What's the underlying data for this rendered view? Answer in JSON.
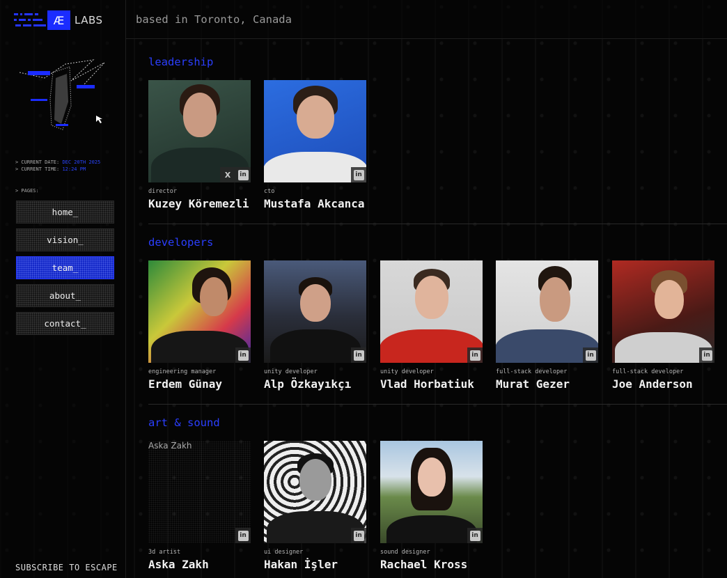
{
  "brand": {
    "logo_mark": "Æ",
    "logo_text": "LABS"
  },
  "header": {
    "location": "based in Toronto, Canada"
  },
  "sidebar": {
    "meta": {
      "date_label": "> CURRENT DATE:",
      "date_value": "DEC 20TH 2025",
      "time_label": "> CURRENT TIME:",
      "time_value": "12:24 PM"
    },
    "pages_label": "> PAGES:",
    "nav": [
      "home_",
      "vision_",
      "team_",
      "about_",
      "contact_"
    ],
    "active": "team_",
    "subscribe": "SUBSCRIBE TO ESCAPE"
  },
  "sections": [
    {
      "title": "leadership",
      "members": [
        {
          "role": "director",
          "name": "Kuzey Köremezli",
          "socials": [
            "x-icon",
            "linkedin-icon"
          ]
        },
        {
          "role": "cto",
          "name": "Mustafa Akcanca",
          "socials": [
            "linkedin-icon"
          ]
        }
      ]
    },
    {
      "title": "developers",
      "members": [
        {
          "role": "engineering manager",
          "name": "Erdem Günay",
          "socials": [
            "linkedin-icon"
          ]
        },
        {
          "role": "unity developer",
          "name": "Alp Özkayıkçı",
          "socials": [
            "linkedin-icon"
          ]
        },
        {
          "role": "unity developer",
          "name": "Vlad Horbatiuk",
          "socials": [
            "linkedin-icon"
          ]
        },
        {
          "role": "full-stack developer",
          "name": "Murat Gezer",
          "socials": [
            "linkedin-icon"
          ]
        },
        {
          "role": "full-stack developer",
          "name": "Joe Anderson",
          "socials": [
            "linkedin-icon"
          ]
        }
      ]
    },
    {
      "title": "art & sound",
      "members": [
        {
          "role": "3d artist",
          "name": "Aska Zakh",
          "socials": [
            "linkedin-icon"
          ],
          "image_alt": "Aska Zakh"
        },
        {
          "role": "ui designer",
          "name": "Hakan İşler",
          "socials": [
            "linkedin-icon"
          ]
        },
        {
          "role": "sound designer",
          "name": "Rachael Kross",
          "socials": [
            "linkedin-icon"
          ]
        }
      ]
    }
  ],
  "icons": {
    "x": "X",
    "linkedin": "in"
  },
  "colors": {
    "accent": "#1b2cff",
    "section_title": "#2b3fff",
    "background": "#050505"
  }
}
